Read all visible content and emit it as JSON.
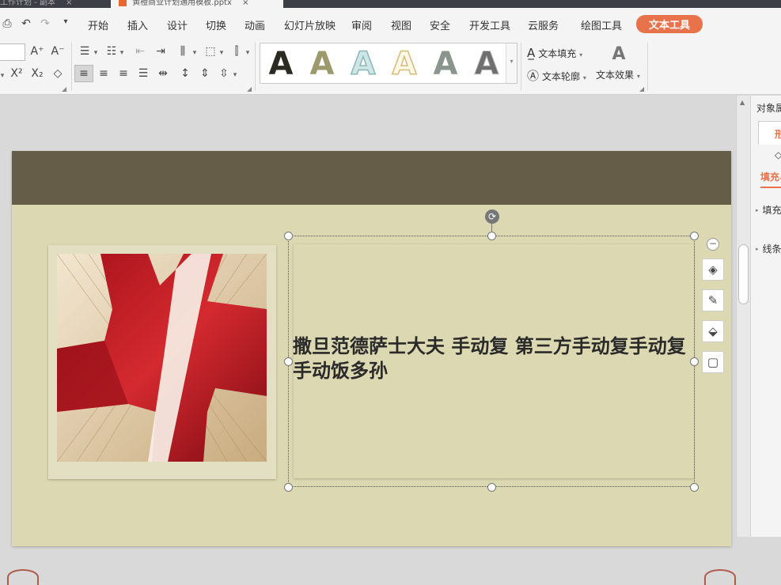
{
  "tabs": [
    {
      "label": "工作计划 - 副本",
      "close": "×",
      "active": false
    },
    {
      "label": "黄橙商业计划通用模板.pptx",
      "close": "×",
      "active": true
    }
  ],
  "quick_access": {
    "preview_icon": "print-preview-icon",
    "undo_icon": "undo-icon",
    "redo_icon": "redo-icon",
    "more_icon": "chevron-down-icon"
  },
  "menu": {
    "items": [
      "开始",
      "插入",
      "设计",
      "切换",
      "动画",
      "幻灯片放映",
      "审阅",
      "视图",
      "安全",
      "开发工具",
      "云服务",
      "绘图工具"
    ],
    "active_tool": "文本工具"
  },
  "ribbon": {
    "font": {
      "grow": "A⁺",
      "shrink": "A⁻",
      "superscript": "X²",
      "subscript": "X₂",
      "clear": "◇"
    },
    "wordart_styles": [
      {
        "letter": "A",
        "fill": "#2b2b22",
        "stroke": "none"
      },
      {
        "letter": "A",
        "fill": "#9c9a6c",
        "stroke": "none"
      },
      {
        "letter": "A",
        "fill": "#cfe6e6",
        "stroke": "#8bb7b8"
      },
      {
        "letter": "A",
        "fill": "#fff8e6",
        "stroke": "#d9b979"
      },
      {
        "letter": "A",
        "fill": "#8a958c",
        "stroke": "none"
      },
      {
        "letter": "A",
        "fill": "#6f6f6f",
        "stroke": "#c0c0c0"
      }
    ],
    "text_fill": "文本填充",
    "text_outline": "文本轮廓",
    "text_effects": "文本效果"
  },
  "slide": {
    "header_color": "#665d48",
    "background_color": "#dcd8b1",
    "text": "撒旦范德萨士大夫 手动复 第三方手动复手动复手动饭多孙"
  },
  "float_tools": [
    "layers-icon",
    "brush-icon",
    "fill-icon",
    "frame-icon"
  ],
  "right_panel": {
    "title": "对象属性",
    "tab": "形状选项",
    "sub_tab": "填充与线条",
    "rows": [
      "填充",
      "线条"
    ]
  }
}
